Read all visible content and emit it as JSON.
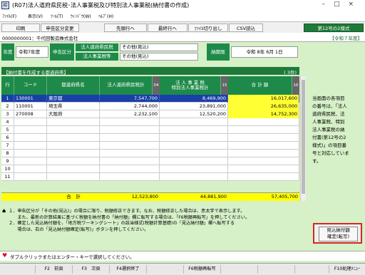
{
  "window": {
    "title": "(R07)法人道府県民税･法人事業税及び特別法人事業税(納付書の作成)",
    "icon_text": "給"
  },
  "menu": [
    "ﾌｧｲﾙ(F)",
    "表示(V)",
    "ﾂｰﾙ(T)",
    "ｳｨﾝﾄﾞｳ(W)",
    "ﾍﾙﾌﾟ(H)"
  ],
  "toolbar": {
    "print": "印刷",
    "declaration_change": "申告区分変更",
    "first_row": "先頭行へ",
    "last_row": "最終行へ",
    "file_export": "ﾌｧｲﾙ切り出し",
    "csv_import": "CSV読込",
    "form_name": "第12号の2様式"
  },
  "company": {
    "code_name": "0000000001：千代田製造株式会社",
    "reiwa_year": "【令和７年度】"
  },
  "header": {
    "nendo_label": "年度",
    "nendo_value": "令和7年度",
    "declaration_label": "申告区分",
    "tax1_label": "法人道府県民税",
    "tax1_value": "その他(見込)",
    "tax2_label": "法人事業税等",
    "tax2_value": "その他(見込)",
    "due_label": "納期限",
    "due_value": "令和 8年 6月 1日"
  },
  "section": {
    "title": "【納付書を作成する都道府県】",
    "count": "( 3件)"
  },
  "table": {
    "headers": {
      "row": "行",
      "code": "コード",
      "pref": "都道府県名",
      "residence_tax": "法人道府県民税計",
      "colno1": "04",
      "enterprise_tax_1": "法 人 事 業 税",
      "enterprise_tax_2": "特別法人事業税計",
      "colno2": "15",
      "total": "合 計 額",
      "colno3": "16"
    },
    "rows": [
      {
        "row": "1",
        "code": "130001",
        "pref": "東京都",
        "residence_tax": "7,547,700",
        "enterprise_tax": "8,469,900",
        "total": "16,017,600"
      },
      {
        "row": "2",
        "code": "110001",
        "pref": "埼玉県",
        "residence_tax": "2,744,000",
        "enterprise_tax": "23,891,000",
        "total": "26,635,000"
      },
      {
        "row": "3",
        "code": "270008",
        "pref": "大阪府",
        "residence_tax": "2,232,100",
        "enterprise_tax": "12,520,200",
        "total": "14,752,300"
      },
      {
        "row": "4",
        "code": "",
        "pref": "",
        "residence_tax": "",
        "enterprise_tax": "",
        "total": ""
      },
      {
        "row": "5",
        "code": "",
        "pref": "",
        "residence_tax": "",
        "enterprise_tax": "",
        "total": ""
      },
      {
        "row": "6",
        "code": "",
        "pref": "",
        "residence_tax": "",
        "enterprise_tax": "",
        "total": ""
      },
      {
        "row": "7",
        "code": "",
        "pref": "",
        "residence_tax": "",
        "enterprise_tax": "",
        "total": ""
      },
      {
        "row": "8",
        "code": "",
        "pref": "",
        "residence_tax": "",
        "enterprise_tax": "",
        "total": ""
      },
      {
        "row": "9",
        "code": "",
        "pref": "",
        "residence_tax": "",
        "enterprise_tax": "",
        "total": ""
      },
      {
        "row": "10",
        "code": "",
        "pref": "",
        "residence_tax": "",
        "enterprise_tax": "",
        "total": ""
      },
      {
        "row": "11",
        "code": "",
        "pref": "",
        "residence_tax": "",
        "enterprise_tax": "",
        "total": ""
      }
    ],
    "total_row": {
      "label": "合　計",
      "residence_tax": "12,523,800",
      "enterprise_tax": "44,881,900",
      "total": "57,405,700"
    }
  },
  "side_note": [
    "当画面の各項目",
    "の番号は、「法人",
    "道府県民税、法",
    "人事業税、特別",
    "法人事業税の納",
    "付書(第12号の2",
    "様式)」の項目番",
    "号と対応していま",
    "す。"
  ],
  "notes": [
    "１．申告区分が「その他(見込)」の場合に限り、税額修正できます。なお、税額修正した場合は、赤太字で表示します。",
    "　　また、最新の計算結果に基づく税額を納付書の「納付額」欄に転写する場合は、「F6税額再転写」を押してください。",
    "２．確定した見込納付額を、「地方税ワーキングシート」の該当様式(税額計算基礎)の「見込納付額」欄へ転写する",
    "　　場合は、右の「見込納付額確定(転写)」ボタンを押してください。"
  ],
  "side_button": {
    "line1": "見込納付額",
    "line2": "確定(転写)"
  },
  "status": {
    "text": "ダブルクリックまたはエンター・キーで選択してください。"
  },
  "fkeys": [
    "F2　前頁",
    "F3　次頁",
    "F4選択終了",
    "F6税額再転写",
    "F10処理ﾒﾆｭｰ"
  ],
  "colors": {
    "header_green": "#1e8a4a",
    "selected_row": "#1a3fa8",
    "total_yellow": "#ffff00",
    "highlight_red": "#d3281e",
    "background": "#d6f0c8"
  }
}
